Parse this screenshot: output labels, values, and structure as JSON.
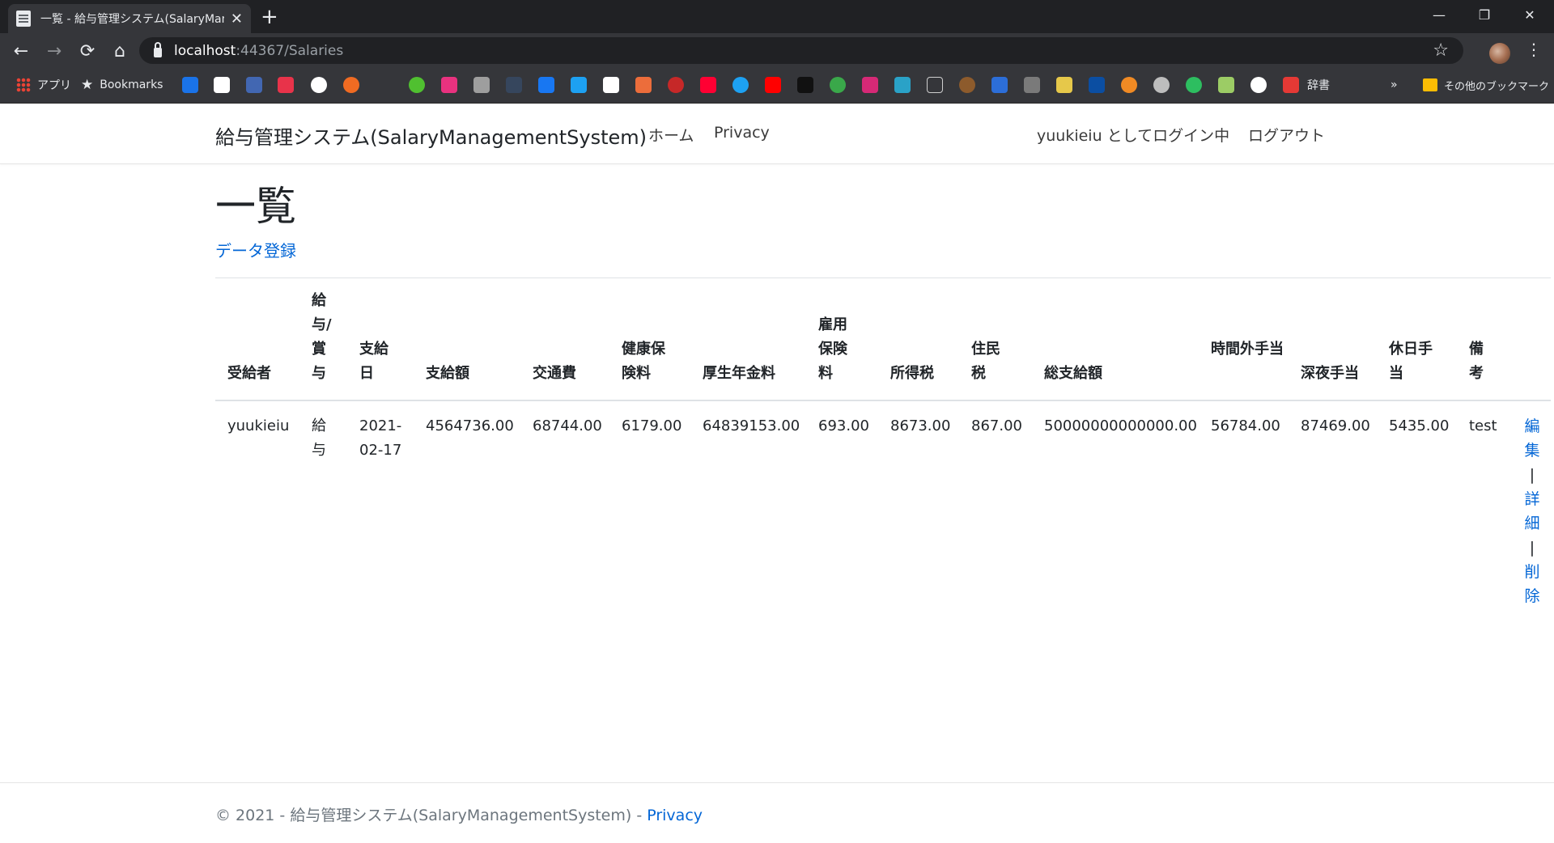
{
  "browser": {
    "tab_title": "一覧 - 給与管理システム(SalaryManagementSystem)",
    "new_tab": "+",
    "window_controls": {
      "minimize": "—",
      "restore": "❐",
      "close": "✕"
    },
    "nav": {
      "back": "←",
      "forward": "→",
      "reload": "⟳",
      "home": "⌂"
    },
    "url_host": "localhost",
    "url_rest": ":44367/Salaries",
    "bookmark_star": "☆",
    "menu": "⋮",
    "bookmarks": {
      "apps_label": "アプリ",
      "bookmarks_label": "Bookmarks",
      "dictionary_label": "辞書",
      "overflow": "»",
      "other_label": "その他のブックマーク"
    }
  },
  "site_nav": {
    "brand": "給与管理システム(SalaryManagementSystem)",
    "home": "ホーム",
    "privacy": "Privacy",
    "logged_in_as": "yuukieiu としてログイン中",
    "logout": "ログアウト"
  },
  "main": {
    "title": "一覧",
    "create_link": "データ登録",
    "table": {
      "headers": {
        "recipient": "受給者",
        "type": "給与/賞与",
        "pay_date": "支給日",
        "pay_amount": "支給額",
        "transport": "交通費",
        "health_ins": "健康保険料",
        "pension": "厚生年金料",
        "employment_ins": "雇用保険料",
        "income_tax": "所得税",
        "resident_tax": "住民税",
        "total": "総支給額",
        "overtime": "時間外手当",
        "night": "深夜手当",
        "holiday": "休日手当",
        "notes": "備考"
      },
      "rows": [
        {
          "recipient": "yuukieiu",
          "type": "給与",
          "pay_date": "2021-02-17",
          "pay_amount": "4564736.00",
          "transport": "68744.00",
          "health_ins": "6179.00",
          "pension": "64839153.00",
          "employment_ins": "693.00",
          "income_tax": "8673.00",
          "resident_tax": "867.00",
          "total": "50000000000000.00",
          "overtime": "56784.00",
          "night": "87469.00",
          "holiday": "5435.00",
          "notes": "test",
          "actions": {
            "edit": "編集",
            "details": "詳細",
            "delete": "削除",
            "separator": "|"
          }
        }
      ]
    }
  },
  "footer": {
    "text": "© 2021 - 給与管理システム(SalaryManagementSystem) - ",
    "privacy": "Privacy"
  }
}
